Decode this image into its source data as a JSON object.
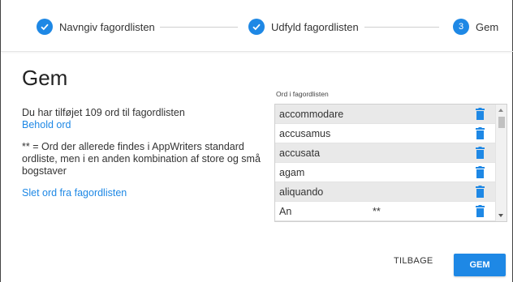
{
  "stepper": {
    "steps": [
      {
        "label": "Navngiv fagordlisten",
        "state": "done"
      },
      {
        "label": "Udfyld fagordlisten",
        "state": "done"
      },
      {
        "label": "Gem",
        "state": "active",
        "number": "3"
      }
    ]
  },
  "page": {
    "title": "Gem"
  },
  "info": {
    "added_text": "Du har tilføjet 109 ord til fagordlisten",
    "keep_link": "Behold ord",
    "note": "** = Ord der allerede findes i AppWriters standard ordliste, men i en anden kombination af store og små bogstaver",
    "delete_link": "Slet ord fra fagordlisten"
  },
  "wordlist": {
    "label": "Ord i fagordlisten",
    "items": [
      {
        "word": "accommodare",
        "mark": ""
      },
      {
        "word": "accusamus",
        "mark": ""
      },
      {
        "word": "accusata",
        "mark": ""
      },
      {
        "word": "agam",
        "mark": ""
      },
      {
        "word": "aliquando",
        "mark": ""
      },
      {
        "word": "An",
        "mark": "**"
      }
    ]
  },
  "buttons": {
    "back": "TILBAGE",
    "save": "GEM"
  },
  "colors": {
    "accent": "#1e88e5",
    "row_shade": "#e9e9e9"
  }
}
